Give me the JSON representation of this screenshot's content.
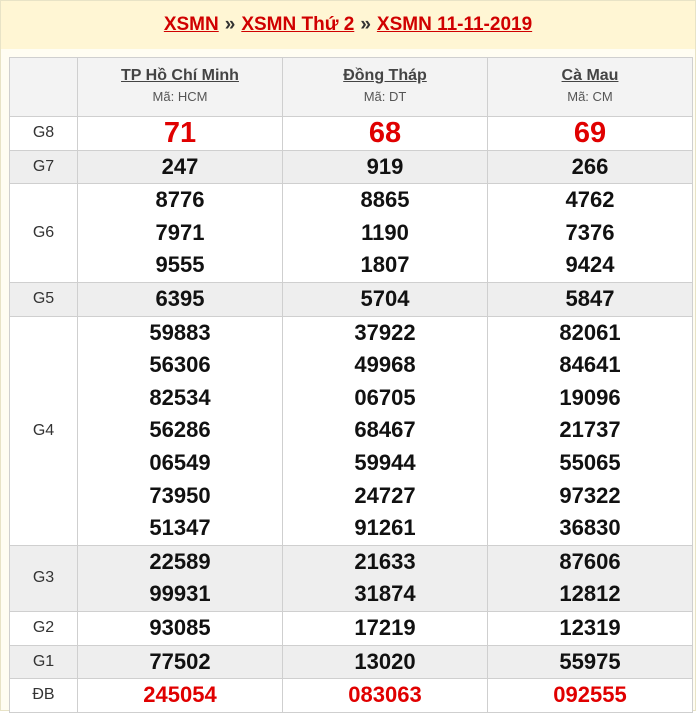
{
  "breadcrumb": {
    "item1": "XSMN",
    "item2": "XSMN Thứ 2",
    "item3": "XSMN 11-11-2019",
    "separator": "»"
  },
  "provinces": [
    {
      "name": "TP Hồ Chí Minh",
      "code": "Mã: HCM"
    },
    {
      "name": "Đồng Tháp",
      "code": "Mã: DT"
    },
    {
      "name": "Cà Mau",
      "code": "Mã: CM"
    }
  ],
  "prizes": {
    "g8": {
      "label": "G8",
      "values": [
        [
          "71"
        ],
        [
          "68"
        ],
        [
          "69"
        ]
      ]
    },
    "g7": {
      "label": "G7",
      "values": [
        [
          "247"
        ],
        [
          "919"
        ],
        [
          "266"
        ]
      ]
    },
    "g6": {
      "label": "G6",
      "values": [
        [
          "8776",
          "7971",
          "9555"
        ],
        [
          "8865",
          "1190",
          "1807"
        ],
        [
          "4762",
          "7376",
          "9424"
        ]
      ]
    },
    "g5": {
      "label": "G5",
      "values": [
        [
          "6395"
        ],
        [
          "5704"
        ],
        [
          "5847"
        ]
      ]
    },
    "g4": {
      "label": "G4",
      "values": [
        [
          "59883",
          "56306",
          "82534",
          "56286",
          "06549",
          "73950",
          "51347"
        ],
        [
          "37922",
          "49968",
          "06705",
          "68467",
          "59944",
          "24727",
          "91261"
        ],
        [
          "82061",
          "84641",
          "19096",
          "21737",
          "55065",
          "97322",
          "36830"
        ]
      ]
    },
    "g3": {
      "label": "G3",
      "values": [
        [
          "22589",
          "99931"
        ],
        [
          "21633",
          "31874"
        ],
        [
          "87606",
          "12812"
        ]
      ]
    },
    "g2": {
      "label": "G2",
      "values": [
        [
          "93085"
        ],
        [
          "17219"
        ],
        [
          "12319"
        ]
      ]
    },
    "g1": {
      "label": "G1",
      "values": [
        [
          "77502"
        ],
        [
          "13020"
        ],
        [
          "55975"
        ]
      ]
    },
    "db": {
      "label": "ĐB",
      "values": [
        [
          "245054"
        ],
        [
          "083063"
        ],
        [
          "092555"
        ]
      ]
    }
  },
  "colors": {
    "accent_red": "#e00000",
    "breadcrumb_bg": "#fff6d4",
    "alt_row_bg": "#eeeeee"
  }
}
